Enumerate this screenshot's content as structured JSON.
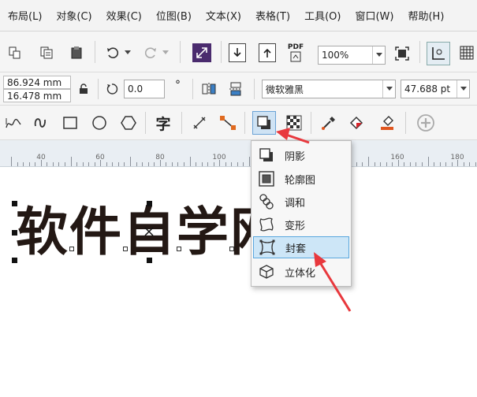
{
  "menubar": {
    "items": [
      "布局(L)",
      "对象(C)",
      "效果(C)",
      "位图(B)",
      "文本(X)",
      "表格(T)",
      "工具(O)",
      "窗口(W)",
      "帮助(H)"
    ]
  },
  "standard_toolbar": {
    "zoom_value": "100%",
    "pdf_label": "PDF"
  },
  "property_bar": {
    "width_value": "86.924 mm",
    "height_value": "16.478 mm",
    "rotation_value": "0.0",
    "degree_symbol": "°",
    "font_name": "微软雅黑",
    "font_size": "47.688 pt"
  },
  "toolbox": {
    "text_tool_glyph": "字"
  },
  "ruler": {
    "labels": [
      "40",
      "60",
      "80",
      "100",
      "160",
      "180"
    ]
  },
  "canvas": {
    "text": "软件自学网"
  },
  "effects_flyout": {
    "items": [
      {
        "label": "阴影",
        "icon": "drop-shadow-icon"
      },
      {
        "label": "轮廓图",
        "icon": "contour-icon"
      },
      {
        "label": "调和",
        "icon": "blend-icon"
      },
      {
        "label": "变形",
        "icon": "distort-icon"
      },
      {
        "label": "封套",
        "icon": "envelope-icon",
        "selected": true
      },
      {
        "label": "立体化",
        "icon": "extrude-icon"
      }
    ]
  },
  "colors": {
    "annotation_arrow": "#e8383d",
    "selection_highlight": "#cde6f7",
    "text_color": "#231814"
  }
}
